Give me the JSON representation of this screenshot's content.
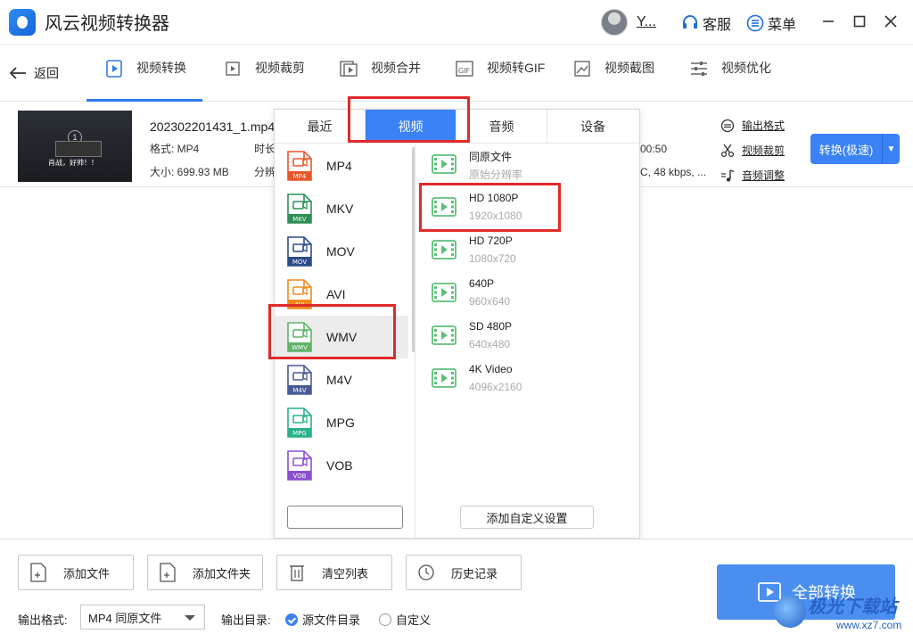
{
  "app": {
    "title": "风云视频转换器",
    "user": "Y..."
  },
  "titlebar": {
    "service": "客服",
    "menu": "菜单"
  },
  "nav": {
    "back": "返回",
    "tabs": [
      "视频转换",
      "视频裁剪",
      "视频合并",
      "视频转GIF",
      "视频截图",
      "视频优化"
    ]
  },
  "file": {
    "name": "202302201431_1.mp4",
    "format": "格式: MP4",
    "size": "大小: 699.93 MB",
    "duration_partial": "时长",
    "resolution_partial": "分辨",
    "time_tail": "00:50",
    "audio_tail": "C, 48 kbps, ...",
    "thumb_caption": "肖战，好帅！！",
    "thumb_number": "1",
    "links": {
      "output_format": "输出格式",
      "video_crop": "视频裁剪",
      "audio_adjust": "音频调整"
    },
    "convert": "转换(极速)"
  },
  "popup": {
    "tabs": [
      "最近",
      "视频",
      "音频",
      "设备"
    ],
    "formats": [
      {
        "name": "MP4",
        "color": "#e8572a"
      },
      {
        "name": "MKV",
        "color": "#2e8f56"
      },
      {
        "name": "MOV",
        "color": "#2c4a8a"
      },
      {
        "name": "AVI",
        "color": "#f08a1c"
      },
      {
        "name": "WMV",
        "color": "#5fb36a"
      },
      {
        "name": "M4V",
        "color": "#4a5a96"
      },
      {
        "name": "MPG",
        "color": "#2ab08a"
      },
      {
        "name": "VOB",
        "color": "#8a4fd0"
      }
    ],
    "resolutions": [
      {
        "name": "同原文件",
        "sub": "原始分辨率"
      },
      {
        "name": "HD 1080P",
        "sub": "1920x1080"
      },
      {
        "name": "HD 720P",
        "sub": "1080x720"
      },
      {
        "name": "640P",
        "sub": "960x640"
      },
      {
        "name": "SD 480P",
        "sub": "640x480"
      },
      {
        "name": "4K Video",
        "sub": "4096x2160"
      }
    ],
    "custom": "添加自定义设置"
  },
  "bottom": {
    "add_file": "添加文件",
    "add_folder": "添加文件夹",
    "clear": "清空列表",
    "history": "历史记录",
    "output_format_label": "输出格式:",
    "output_format_value": "MP4 同原文件",
    "output_dir_label": "输出目录:",
    "source_dir": "源文件目录",
    "custom_dir": "自定义",
    "convert_all": "全部转换"
  },
  "watermark": {
    "text": "极光下载站",
    "url": "www.xz7.com"
  },
  "colors": {
    "accent": "#3b82f6",
    "highlight": "#e12a2a"
  }
}
